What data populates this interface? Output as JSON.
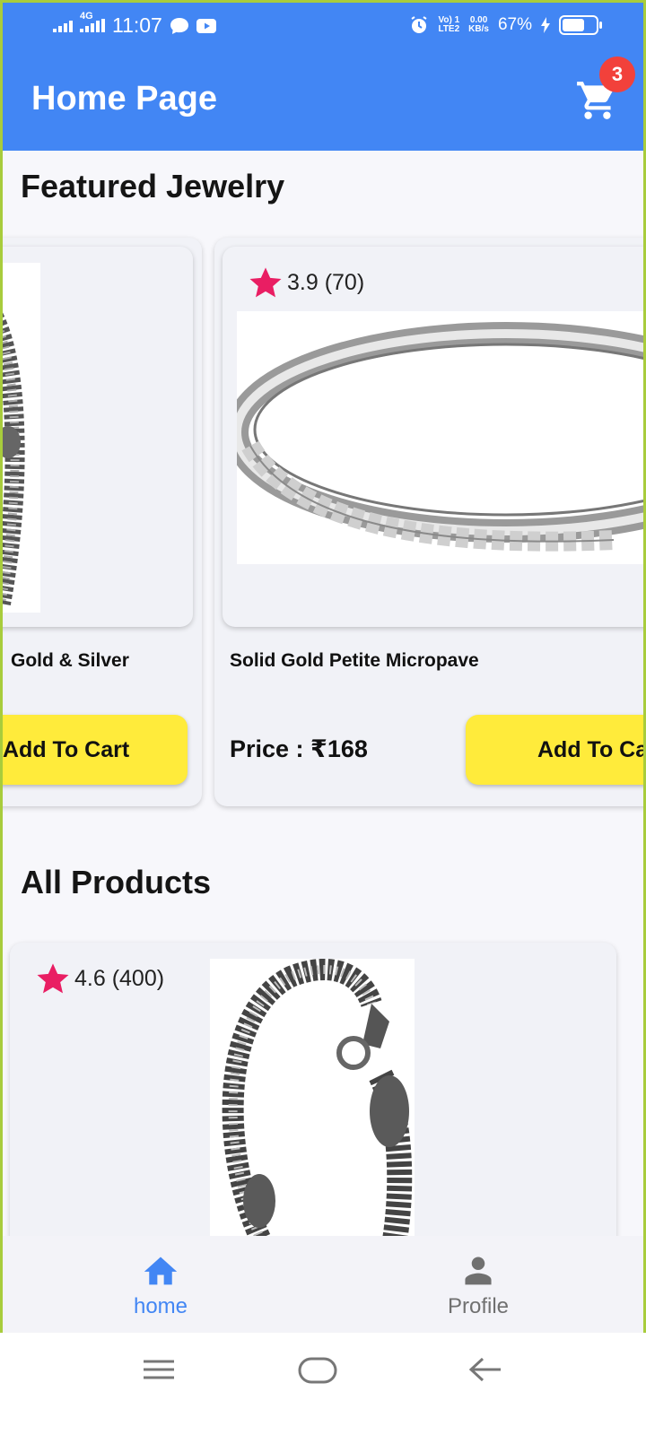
{
  "status_bar": {
    "time": "11:07",
    "network_type": "4G",
    "volte": "Vo) 1\nLTE2",
    "speed_value": "0.00",
    "speed_unit": "KB/s",
    "battery": "67%"
  },
  "app_bar": {
    "title": "Home Page",
    "cart_count": "3"
  },
  "featured": {
    "title": "Featured Jewelry",
    "items": [
      {
        "name": "Gold & Silver",
        "add_label": "Add To Cart"
      },
      {
        "rating": "3.9 (70)",
        "name": "Solid Gold Petite Micropave",
        "price": "Price : ₹168",
        "add_label": "Add To Ca"
      }
    ]
  },
  "all_products": {
    "title": "All Products",
    "items": [
      {
        "rating": "4.6 (400)"
      }
    ]
  },
  "bottom_nav": {
    "home": "home",
    "profile": "Profile"
  },
  "colors": {
    "app_bar": "#4286f4",
    "accent_button": "#ffeb3b",
    "star": "#e91e63",
    "badge": "#f2413b"
  }
}
